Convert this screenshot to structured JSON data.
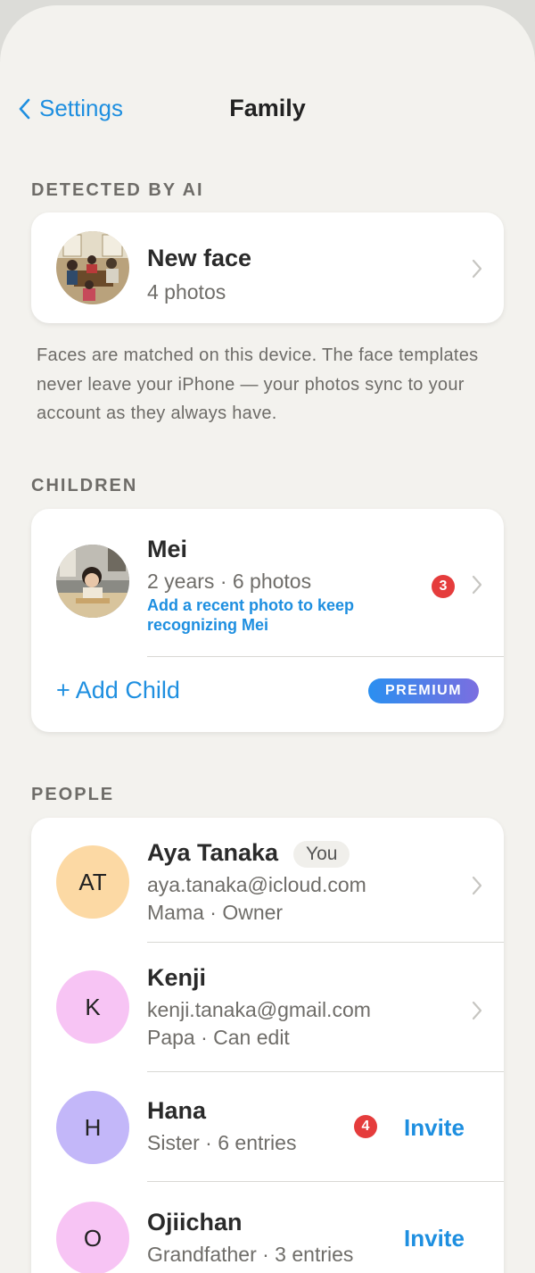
{
  "nav": {
    "back_label": "Settings",
    "title": "Family"
  },
  "detected": {
    "section_label": "DETECTED BY AI",
    "title": "New face",
    "subtitle": "4 photos",
    "note": "Faces are matched on this device. The face templates never leave your iPhone — your photos sync to your account as they always have."
  },
  "children": {
    "section_label": "CHILDREN",
    "child": {
      "name": "Mei",
      "meta": "2 years · 6 photos",
      "hint": "Add a recent photo to keep recognizing Mei",
      "badge": "3"
    },
    "add_label": "+ Add Child",
    "premium_label": "PREMIUM"
  },
  "people": {
    "section_label": "PEOPLE",
    "items": [
      {
        "initials": "AT",
        "name": "Aya Tanaka",
        "tag": "You",
        "line1": "aya.tanaka@icloud.com",
        "line2": "Mama · Owner",
        "color": "#fcd9a4"
      },
      {
        "initials": "K",
        "name": "Kenji",
        "line1": "kenji.tanaka@gmail.com",
        "line2": "Papa · Can edit",
        "color": "#f7c4f4"
      },
      {
        "initials": "H",
        "name": "Hana",
        "line1": "Sister · 6 entries",
        "badge": "4",
        "action": "Invite",
        "color": "#c3b7f9"
      },
      {
        "initials": "O",
        "name": "Ojiichan",
        "line1": "Grandfather · 3 entries",
        "action": "Invite",
        "color": "#f7c4f4"
      }
    ]
  },
  "colors": {
    "accent": "#1e8fe0",
    "badge": "#e53c3c",
    "background": "#f3f2ee"
  }
}
